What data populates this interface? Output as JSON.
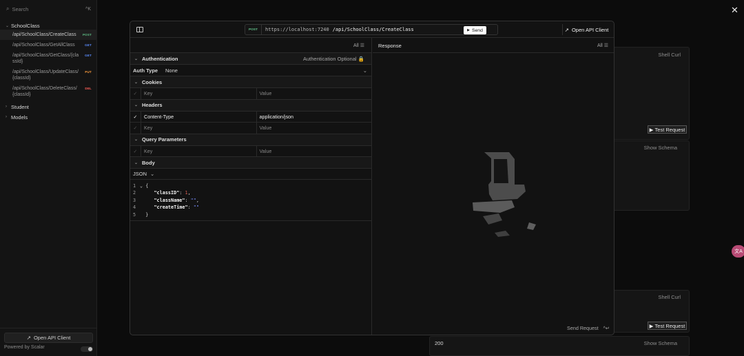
{
  "sidebar": {
    "search_label": "Search",
    "shortcut": "^K",
    "group_label": "SchoolClass",
    "endpoints": [
      {
        "path": "/api/SchoolClass/CreateClass",
        "method": "POST",
        "method_color": "#5fbf86"
      },
      {
        "path": "/api/SchoolClass/GetAllClass",
        "method": "GET",
        "method_color": "#5b8dff"
      },
      {
        "path": "/api/SchoolClass/GetClass/{classId}",
        "method": "GET",
        "method_color": "#5b8dff"
      },
      {
        "path": "/api/SchoolClass/UpdateClass/{classId}",
        "method": "PUT",
        "method_color": "#ff9d3d"
      },
      {
        "path": "/api/SchoolClass/DeleteClass/{classId}",
        "method": "DEL",
        "method_color": "#ff5f59"
      }
    ],
    "groups": [
      "Student",
      "Models"
    ],
    "open_client_label": "Open API Client",
    "powered_by": "Powered by Scalar"
  },
  "modal": {
    "method": "POST",
    "host": "https://localhost:7240",
    "path": "/api/SchoolClass/CreateClass",
    "send_label": "Send",
    "open_client_label": "Open API Client",
    "left_filter": "All",
    "auth_title": "Authentication",
    "auth_status": "Authentication Optional",
    "auth_type_label": "Auth Type",
    "auth_type_value": "None",
    "cookies_title": "Cookies",
    "headers_title": "Headers",
    "query_title": "Query Parameters",
    "body_title": "Body",
    "key_placeholder": "Key",
    "value_placeholder": "Value",
    "header_key": "Content-Type",
    "header_value": "application/json",
    "body_format": "JSON",
    "code": {
      "ln1": "1",
      "ln2": "2",
      "ln3": "3",
      "ln4": "4",
      "ln5": "5",
      "open": "{",
      "key1": "\"classID\"",
      "val1": "1",
      "key2": "\"className\"",
      "val2": "\"\"",
      "key3": "\"createTime\"",
      "val3": "\"\"",
      "close": "}"
    },
    "response_title": "Response",
    "right_filter": "All",
    "send_request_label": "Send Request",
    "send_request_shortcut": "^↵"
  },
  "background": {
    "shell_curl": "Shell Curl",
    "test_request": "Test Request",
    "show_schema": "Show Schema",
    "status_code": "200",
    "translate_glyph": "文A"
  }
}
